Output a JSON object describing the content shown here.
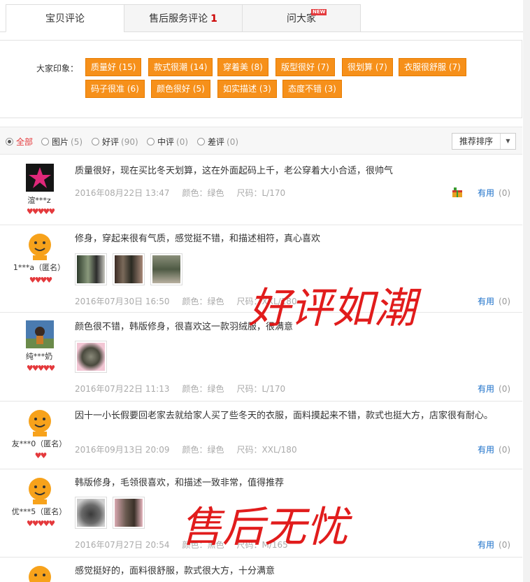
{
  "tabs": [
    {
      "label": "宝贝评论",
      "count": ""
    },
    {
      "label": "售后服务评论",
      "count": "1"
    },
    {
      "label": "问大家",
      "badge": "NEW"
    }
  ],
  "impressions": {
    "label": "大家印象：",
    "tags": [
      "质量好 (15)",
      "款式很潮 (14)",
      "穿着美 (8)",
      "版型很好 (7)",
      "很划算 (7)",
      "衣服很舒服 (7)",
      "码子很准 (6)",
      "颜色很好 (5)",
      "如实描述 (3)",
      "态度不错 (3)"
    ]
  },
  "filters": [
    {
      "label": "全部",
      "count": ""
    },
    {
      "label": "图片",
      "count": "(5)"
    },
    {
      "label": "好评",
      "count": "(90)"
    },
    {
      "label": "中评",
      "count": "(0)"
    },
    {
      "label": "差评",
      "count": "(0)"
    }
  ],
  "sort": {
    "label": "推荐排序"
  },
  "reviews": [
    {
      "user": "渲***z",
      "hearts": "♥♥♥♥♥",
      "text": "质量很好，现在买比冬天划算，这在外面起码上千，老公穿着大小合适，很帅气",
      "date": "2016年08月22日 13:47",
      "color": "颜色：绿色",
      "size": "尺码：L/170",
      "useful": "有用",
      "useful_count": "(0)"
    },
    {
      "user": "1***a（匿名）",
      "hearts": "♥♥♥♥",
      "text": "修身，穿起来很有气质，感觉挺不错，和描述相符，真心喜欢",
      "date": "2016年07月30日 16:50",
      "color": "颜色：绿色",
      "size": "尺码：XXL/180",
      "useful": "有用",
      "useful_count": "(0)"
    },
    {
      "user": "纯***奶",
      "hearts": "♥♥♥♥♥",
      "text": "颜色很不错，韩版修身，很喜欢这一款羽绒服，很满意",
      "date": "2016年07月22日 11:13",
      "color": "颜色：绿色",
      "size": "尺码：L/170",
      "useful": "有用",
      "useful_count": "(0)"
    },
    {
      "user": "友***0（匿名）",
      "hearts": "♥♥",
      "text": "因十一小长假要回老家去就给家人买了些冬天的衣服，面料摸起来不错，款式也挺大方，店家很有耐心。",
      "date": "2016年09月13日 20:09",
      "color": "颜色：绿色",
      "size": "尺码：XXL/180",
      "useful": "有用",
      "useful_count": "(0)"
    },
    {
      "user": "优***5（匿名）",
      "hearts": "♥♥♥♥♥",
      "text": "韩版修身，毛领很喜欢，和描述一致非常，值得推荐",
      "date": "2016年07月27日 20:54",
      "color": "颜色：黑色",
      "size": "尺码：M/165",
      "useful": "有用",
      "useful_count": "(0)"
    },
    {
      "text": "感觉挺好的，面料很舒服，款式很大方，十分满意"
    }
  ],
  "overlays": [
    "好评如潮",
    "售后无忧"
  ],
  "colors": {
    "accent": "#f6901a",
    "link": "#1a6fc9",
    "overlay": "#e01010"
  }
}
